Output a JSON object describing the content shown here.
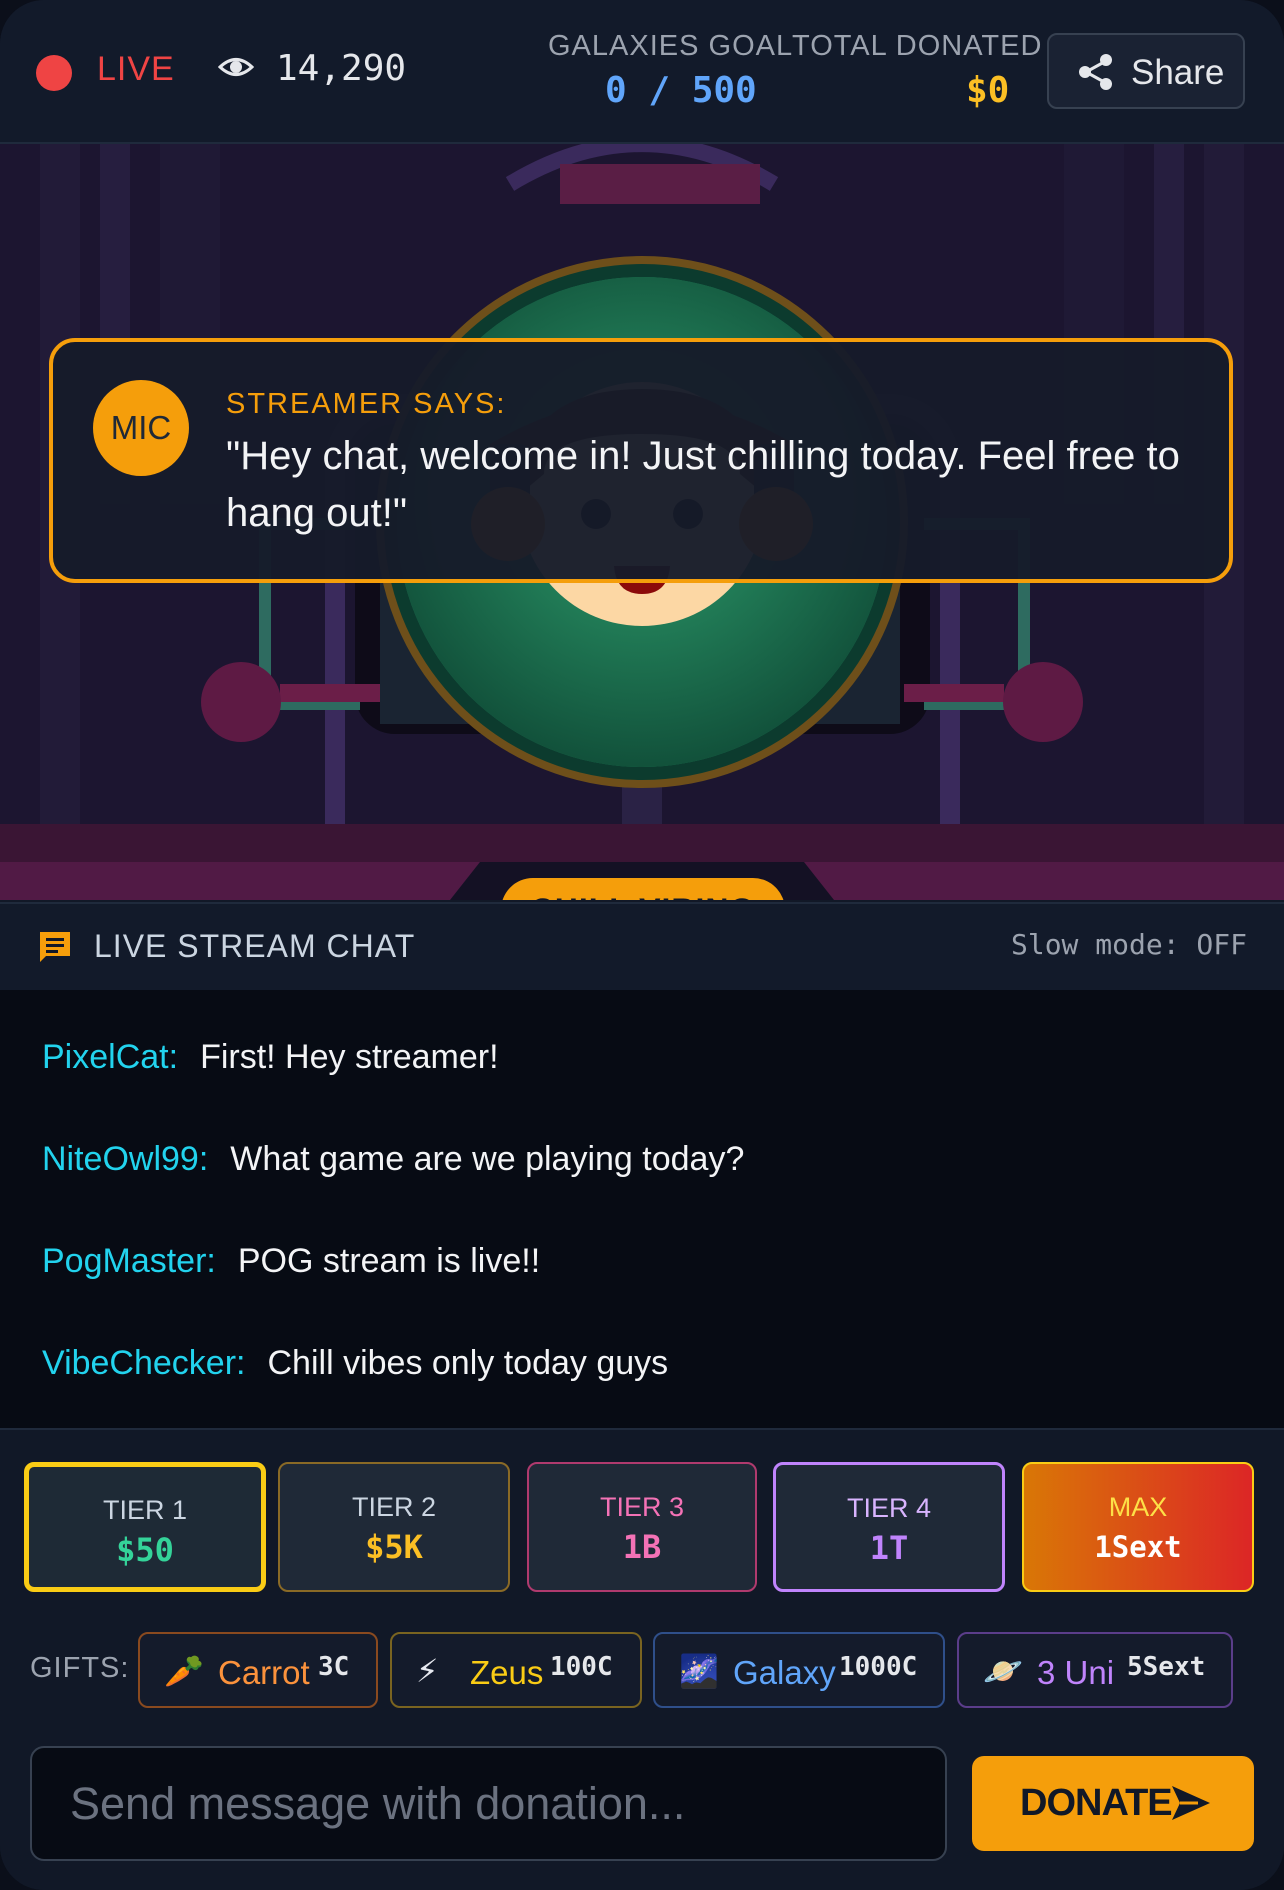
{
  "header": {
    "live_label": "LIVE",
    "viewer_count": "14,290",
    "goal_label": "GALAXIES GOAL",
    "goal_value": "0 / 500",
    "donated_label": "TOTAL DONATED",
    "donated_value": "$0",
    "share_label": "Share"
  },
  "stage": {
    "speech_label": "STREAMER SAYS:",
    "mic_label": "MIC",
    "speech_text": "\"Hey chat, welcome in! Just chilling today. Feel free to hang out!\"",
    "mood": "CHILL VIBING"
  },
  "chat": {
    "title": "LIVE STREAM CHAT",
    "slow_mode": "Slow mode: OFF",
    "messages": [
      {
        "user": "PixelCat:",
        "text": "First! Hey streamer!"
      },
      {
        "user": "NiteOwl99:",
        "text": "What game are we playing today?"
      },
      {
        "user": "PogMaster:",
        "text": "POG stream is live!!"
      },
      {
        "user": "VibeChecker:",
        "text": "Chill vibes only today guys"
      }
    ]
  },
  "tiers": [
    {
      "label": "TIER 1",
      "value": "$50",
      "selected": true
    },
    {
      "label": "TIER 2",
      "value": "$5K"
    },
    {
      "label": "TIER 3",
      "value": "1B"
    },
    {
      "label": "TIER 4",
      "value": "1T"
    },
    {
      "label": "MAX",
      "value": "1Sext"
    }
  ],
  "gifts": {
    "label": "GIFTS:",
    "items": [
      {
        "emoji": "🥕",
        "name": "Carrot",
        "cost": "3C"
      },
      {
        "emoji": "⚡",
        "name": "Zeus",
        "cost": "100C"
      },
      {
        "emoji": "🌌",
        "name": "Galaxy",
        "cost": "1000C"
      },
      {
        "emoji": "🪐",
        "name": "3 Uni",
        "cost": "5Sext"
      }
    ]
  },
  "composer": {
    "placeholder": "Send message with donation...",
    "donate_label": "DONATE"
  },
  "colors": {
    "accent": "#f59e0b",
    "live": "#ef4444",
    "username": "#22d3ee",
    "goal": "#60a5fa",
    "donated": "#fbbf24"
  },
  "icons": {
    "viewers": "eye-icon",
    "share": "share-icon",
    "chat": "chat-bubble-icon",
    "donate": "send-icon"
  }
}
